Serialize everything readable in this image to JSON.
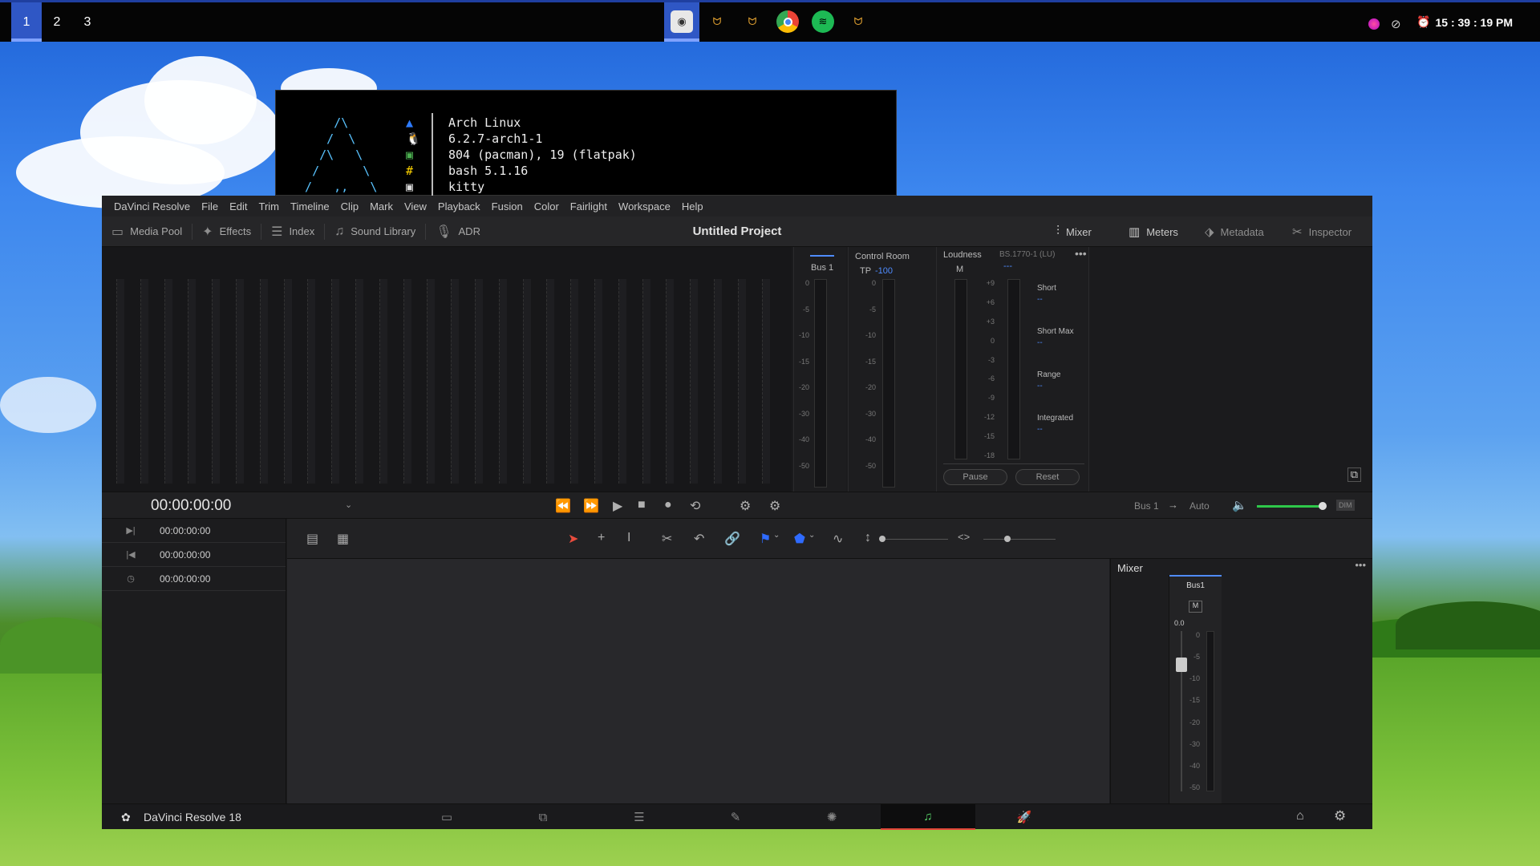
{
  "topbar": {
    "workspaces": [
      "1",
      "2",
      "3"
    ],
    "active_workspace": "1",
    "apps": [
      {
        "icon": "obs-icon"
      },
      {
        "icon": "kitty-icon"
      },
      {
        "icon": "kitty-icon"
      },
      {
        "icon": "chrome-icon"
      },
      {
        "icon": "spotify-icon"
      },
      {
        "icon": "kitty-icon"
      }
    ],
    "clock": "15 : 39 : 19 PM",
    "colors": {
      "accent": "#2f57c5",
      "bar": "#050505"
    }
  },
  "terminal": {
    "info": [
      "Arch Linux",
      "6.2.7-arch1-1",
      "804 (pacman), 19 (flatpak)",
      "bash 5.1.16",
      "kitty"
    ]
  },
  "resolve": {
    "menu": [
      "DaVinci Resolve",
      "File",
      "Edit",
      "Trim",
      "Timeline",
      "Clip",
      "Mark",
      "View",
      "Playback",
      "Fusion",
      "Color",
      "Fairlight",
      "Workspace",
      "Help"
    ],
    "toolbar_left": [
      "Media Pool",
      "Effects",
      "Index",
      "Sound Library",
      "ADR"
    ],
    "project_title": "Untitled Project",
    "toolbar_right": [
      "Mixer",
      "Meters",
      "Metadata",
      "Inspector"
    ],
    "meter_scale": [
      "0",
      "-5",
      "-10",
      "-15",
      "-20",
      "-30",
      "-40",
      "-50"
    ],
    "bus_label": "Bus 1",
    "control_room": {
      "title": "Control Room",
      "tp_label": "TP",
      "tp_value": "-100"
    },
    "loudness": {
      "title": "Loudness",
      "standard": "BS.1770-1 (LU)",
      "m_label": "M",
      "m_value": "---",
      "scale": [
        "+9",
        "+6",
        "+3",
        "0",
        "-3",
        "-6",
        "-9",
        "-12",
        "-15",
        "-18"
      ],
      "readouts": [
        {
          "label": "Short",
          "value": "--"
        },
        {
          "label": "Short Max",
          "value": "--"
        },
        {
          "label": "Range",
          "value": "--"
        },
        {
          "label": "Integrated",
          "value": "--"
        }
      ],
      "pause": "Pause",
      "reset": "Reset"
    },
    "timecode": "00:00:00:00",
    "output_bus": "Bus 1",
    "output_mode": "Auto",
    "dim_label": "DIM",
    "tc_rows": [
      "00:00:00:00",
      "00:00:00:00",
      "00:00:00:00"
    ],
    "mixer": {
      "title": "Mixer",
      "bus": "Bus1",
      "mute": "M",
      "fader_value": "0.0",
      "scale": [
        "0",
        "-5",
        "-10",
        "-15",
        "-20",
        "-30",
        "-40",
        "-50"
      ]
    },
    "app_name": "DaVinci Resolve 18"
  }
}
